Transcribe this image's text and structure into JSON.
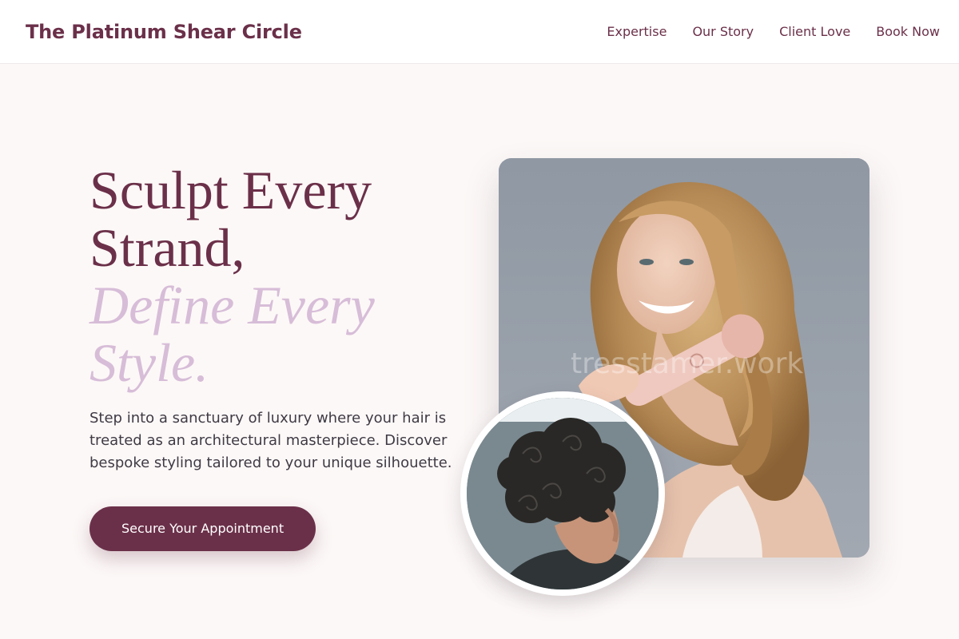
{
  "brand": {
    "name": "The Platinum Shear Circle"
  },
  "nav": {
    "items": [
      {
        "label": "Expertise"
      },
      {
        "label": "Our Story"
      },
      {
        "label": "Client Love"
      },
      {
        "label": "Book Now"
      }
    ]
  },
  "hero": {
    "headline_line1": "Sculpt Every Strand,",
    "headline_line2": "Define Every Style.",
    "subtext": "Step into a sanctuary of luxury where your hair is treated as an architectural masterpiece. Discover bespoke styling tailored to your unique silhouette.",
    "cta_label": "Secure Your Appointment"
  },
  "images": {
    "main_photo": "woman-with-wavy-blonde-hair-and-curling-wand",
    "inset_photo": "man-with-dark-curly-hair",
    "watermark": "tresstamer.work"
  },
  "colors": {
    "brand": "#6b3049",
    "accent": "#d7bdd8",
    "background": "#fcf8f7",
    "text": "#3f3a44"
  }
}
